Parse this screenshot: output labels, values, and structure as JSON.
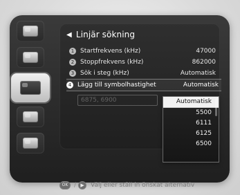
{
  "screen": {
    "title": "Linjär sökning",
    "title_arrow": "◀"
  },
  "menu": {
    "items": [
      {
        "index": "1",
        "label": "Startfrekvens (kHz)",
        "value": "47000"
      },
      {
        "index": "2",
        "label": "Stoppfrekvens (kHz)",
        "value": "862000"
      },
      {
        "index": "3",
        "label": "Sök i steg (kHz)",
        "value": "Automatisk"
      },
      {
        "index": "4",
        "label": "Lägg till symbolhastighet",
        "value": "Automatisk"
      }
    ]
  },
  "ghost_field": {
    "text": "6875, 6900"
  },
  "dropdown": {
    "selected": "Automatisk",
    "options": [
      "Automatisk",
      "5500",
      "6111",
      "6125",
      "6500"
    ]
  },
  "footer": {
    "ok_label": "OK",
    "arrow_label": "▶",
    "slash": "/",
    "hint": "Välj eller ställ in önskat alternativ"
  },
  "sidebar": {
    "tabs": [
      {
        "icon": "people-icon",
        "active": false
      },
      {
        "icon": "folder-icon",
        "active": false
      },
      {
        "icon": "settings-icon",
        "active": true
      },
      {
        "icon": "tools-icon",
        "active": false
      },
      {
        "icon": "globe-icon",
        "active": false
      }
    ]
  }
}
